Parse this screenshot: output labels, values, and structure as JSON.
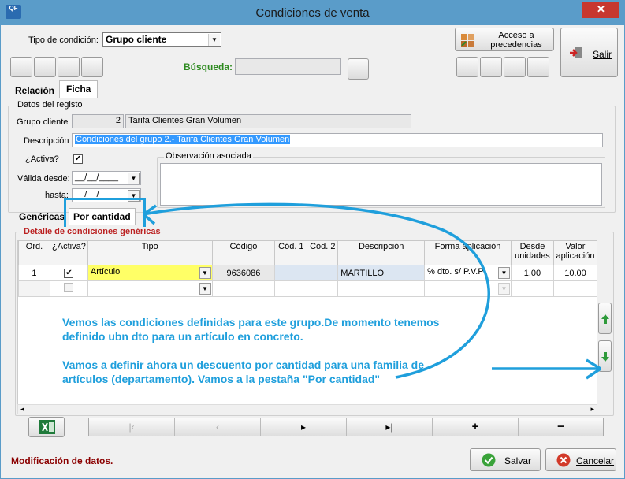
{
  "window": {
    "title": "Condiciones de venta",
    "logo_text": "QF",
    "close_glyph": "✕"
  },
  "top": {
    "tipo_label": "Tipo de condición:",
    "tipo_value": "Grupo cliente",
    "busqueda_label": "Búsqueda:",
    "busqueda_value": "",
    "acceso_label_1": "Acceso a",
    "acceso_label_2": "precedencias",
    "salir_label": "Salir"
  },
  "tabs": {
    "relacion": "Relación",
    "ficha": "Ficha"
  },
  "registro": {
    "group_title": "Datos del registo",
    "grupo_label": "Grupo cliente",
    "grupo_code": "2",
    "grupo_name": "Tarifa Clientes Gran Volumen",
    "descripcion_label": "Descripción",
    "descripcion_value": "Condiciones del grupo 2.- Tarifa Clientes Gran Volumen",
    "activa_label": "¿Activa?",
    "activa_check": "✔",
    "valida_label": "Válida desde:",
    "valida_value": "__/__/____",
    "hasta_label": "hasta:",
    "hasta_value": "__/__/____",
    "observacion_title": "Observación asociada"
  },
  "subtabs": {
    "genericas": "Genéricas",
    "por_cantidad": "Por cantidad"
  },
  "detalle": {
    "group_title": "Detalle de condiciones genéricas",
    "headers": [
      "Ord.",
      "¿Activa?",
      "Tipo",
      "Código",
      "Cód. 1",
      "Cód. 2",
      "Descripción",
      "Forma aplicación",
      "Desde unidades",
      "Valor aplicación"
    ],
    "row1": {
      "ord": "1",
      "activa": "✔",
      "tipo": "Artículo",
      "codigo": "9636086",
      "cod1": "",
      "cod2": "",
      "descripcion": "MARTILLO",
      "forma": "% dto. s/ P.V.P",
      "desde": "1.00",
      "valor": "10.00"
    }
  },
  "annotation": {
    "line1": "Vemos las condiciones definidas para este grupo.De momento tenemos",
    "line2": "definido ubn dto para un artículo en concreto.",
    "line3": "Vamos a definir ahora un descuento por cantidad para una familia de",
    "line4": "artículos (departamento). Vamos a la pestaña \"Por cantidad\""
  },
  "nav": {
    "first": "|‹",
    "prev": "‹",
    "next": "▸",
    "last": "▸|",
    "add": "+",
    "remove": "−"
  },
  "footer": {
    "status": "Modificación de datos.",
    "save_label": "Salvar",
    "cancel_label": "Cancelar"
  },
  "colors": {
    "accent": "#1f9fdc",
    "titlebar": "#5a9cc9",
    "highlight_yellow": "#ffff66",
    "selection": "#3399ff"
  }
}
